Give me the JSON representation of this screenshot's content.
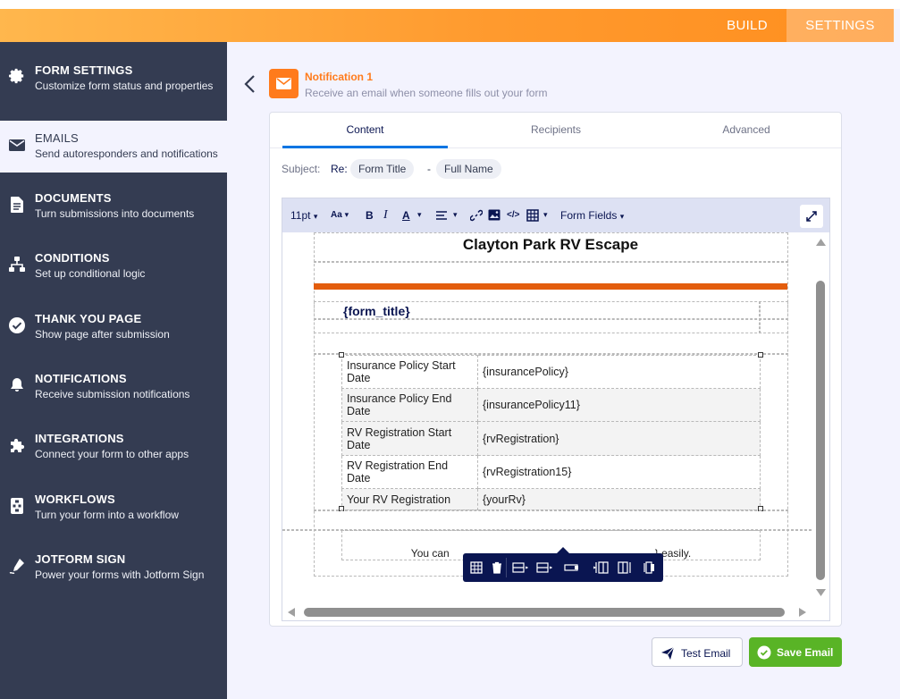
{
  "header": {
    "tabs": [
      {
        "label": "BUILD"
      },
      {
        "label": "SETTINGS"
      }
    ]
  },
  "sidebar": {
    "items": [
      {
        "title": "FORM SETTINGS",
        "subtitle": "Customize form status and properties",
        "icon": "gear-icon"
      },
      {
        "title": "EMAILS",
        "subtitle": "Send autoresponders and notifications",
        "icon": "envelope-icon"
      },
      {
        "title": "DOCUMENTS",
        "subtitle": "Turn submissions into documents",
        "icon": "document-icon"
      },
      {
        "title": "CONDITIONS",
        "subtitle": "Set up conditional logic",
        "icon": "sitemap-icon"
      },
      {
        "title": "THANK YOU PAGE",
        "subtitle": "Show page after submission",
        "icon": "check-circle-icon"
      },
      {
        "title": "NOTIFICATIONS",
        "subtitle": "Receive submission notifications",
        "icon": "bell-icon"
      },
      {
        "title": "INTEGRATIONS",
        "subtitle": "Connect your form to other apps",
        "icon": "puzzle-icon"
      },
      {
        "title": "WORKFLOWS",
        "subtitle": "Turn your form into a workflow",
        "icon": "workflow-icon"
      },
      {
        "title": "JOTFORM SIGN",
        "subtitle": "Power your forms with Jotform Sign",
        "icon": "pen-icon"
      }
    ]
  },
  "notification": {
    "title": "Notification 1",
    "subtitle": "Receive an email when someone fills out your form"
  },
  "tabs": [
    {
      "label": "Content"
    },
    {
      "label": "Recipients"
    },
    {
      "label": "Advanced"
    }
  ],
  "subject": {
    "label": "Subject:",
    "prefix": "Re:",
    "tags": [
      "Form Title",
      "Full Name"
    ],
    "separator": "-"
  },
  "toolbar": {
    "font_size": "11pt",
    "font_family": "Aa",
    "form_fields": "Form Fields"
  },
  "document": {
    "title": "Clayton Park RV Escape",
    "form_title_tag": "{form_title}",
    "rows": [
      {
        "label": "Insurance Policy Start Date",
        "value": "{insurancePolicy}"
      },
      {
        "label": "Insurance Policy End Date",
        "value": "{insurancePolicy11}"
      },
      {
        "label": "RV Registration Start Date",
        "value": "{rvRegistration}"
      },
      {
        "label": "RV Registration End Date",
        "value": "{rvRegistration15}"
      },
      {
        "label": "Your RV Registration",
        "value": "{yourRv}"
      }
    ],
    "footer_prefix": "You can",
    "footer_suffix": "} easily."
  },
  "buttons": {
    "test": "Test Email",
    "save": "Save Email"
  },
  "colors": {
    "accent": "#ff7b1c",
    "sidebar": "#343c52",
    "save": "#59b426",
    "tab_active": "#0075e3",
    "orange_bar": "#e35d0d"
  }
}
